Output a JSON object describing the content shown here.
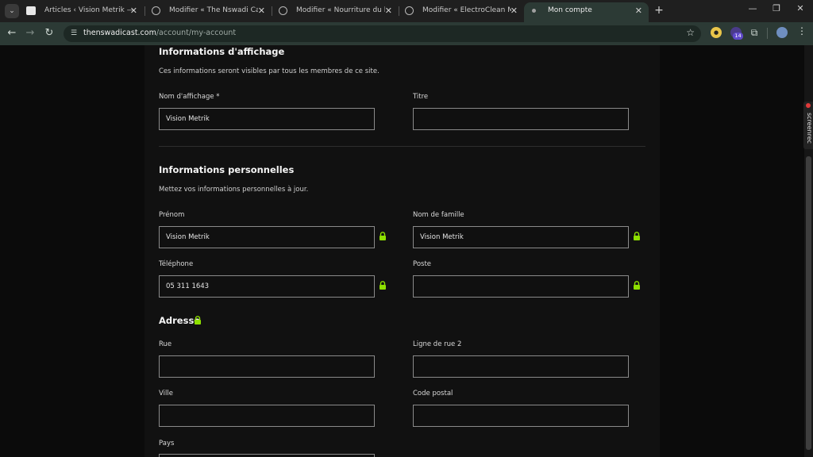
{
  "browser": {
    "tabs": [
      {
        "label": "Articles ‹ Vision Metrik — Word",
        "icon": "wave-icon"
      },
      {
        "label": "Modifier « The Nswadi Cast » a",
        "icon": "globe-icon"
      },
      {
        "label": "Modifier « Nourriture du bonh",
        "icon": "globe-icon"
      },
      {
        "label": "Modifier « ElectroClean Market",
        "icon": "globe-icon"
      },
      {
        "label": "Mon compte",
        "icon": "loading-dot-icon"
      }
    ],
    "close_glyph": "✕",
    "new_tab_glyph": "+",
    "url_host": "thenswadicast.com",
    "url_path": "/account/my-account",
    "extension_badge": "14",
    "colors": {
      "toolbar": "#2c3a35",
      "lock": "#8ee000"
    }
  },
  "sidebar_tool": {
    "label": "screenrec"
  },
  "display_section": {
    "title": "Informations d'affichage",
    "description": "Ces informations seront visibles par tous les membres de ce site.",
    "display_name_label": "Nom d'affichage *",
    "display_name_value": "Vision Metrik",
    "title_label": "Titre",
    "title_value": ""
  },
  "personal_section": {
    "title": "Informations personnelles",
    "description": "Mettez vos informations personnelles à jour.",
    "first_name_label": "Prénom",
    "first_name_value": "Vision Metrik",
    "last_name_label": "Nom de famille",
    "last_name_value": "Vision Metrik",
    "phone_label": "Téléphone",
    "phone_value": "05 311 1643",
    "position_label": "Poste",
    "position_value": ""
  },
  "address_section": {
    "title": "Adresse",
    "street_label": "Rue",
    "street_value": "",
    "street2_label": "Ligne de rue 2",
    "street2_value": "",
    "city_label": "Ville",
    "city_value": "",
    "postal_label": "Code postal",
    "postal_value": "",
    "country_label": "Pays"
  }
}
